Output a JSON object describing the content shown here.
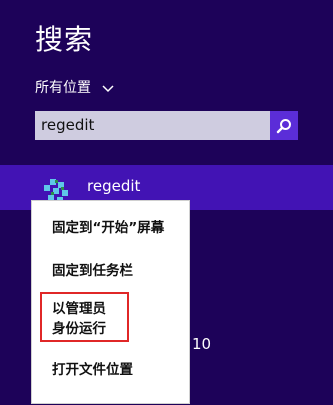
{
  "search": {
    "title": "搜索",
    "scope_label": "所有位置",
    "query": "regedit"
  },
  "result": {
    "label": "regedit",
    "peek": "10"
  },
  "context_menu": {
    "pin_start": "固定到“开始”屏幕",
    "pin_taskbar": "固定到任务栏",
    "run_as_admin_line1": "以管理员",
    "run_as_admin_line2": "身份运行",
    "open_location": "打开文件位置"
  },
  "colors": {
    "background": "#1d0259",
    "result_highlight": "#4213b4",
    "search_button": "#5b2dd8",
    "annotation_box": "#e02727"
  },
  "icons": {
    "scope_chevron": "chevron-down-icon",
    "search_button": "magnifier-icon",
    "app": "regedit-app-icon"
  }
}
